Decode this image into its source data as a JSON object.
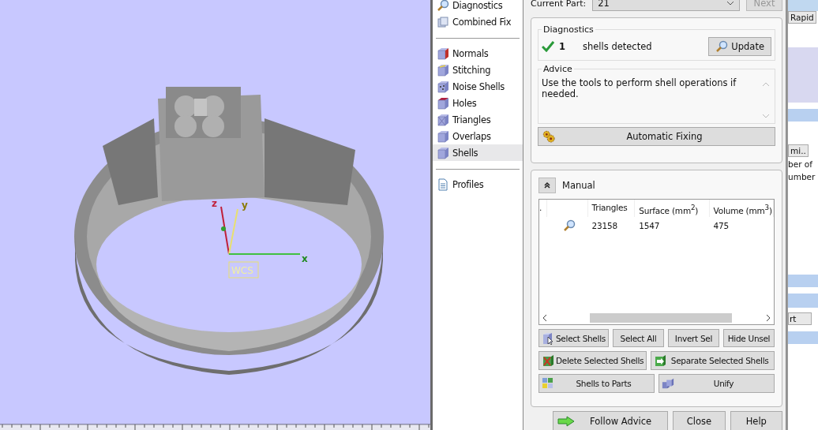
{
  "viewport": {
    "axes": {
      "z": "z",
      "y": "y",
      "x": "x",
      "label": "WCS"
    }
  },
  "nav": {
    "groups": [
      [
        {
          "label": "Diagnostics",
          "kind": "magnifier",
          "selected": false
        },
        {
          "label": "Combined Fix",
          "kind": "stack",
          "selected": false
        }
      ],
      [
        {
          "label": "Normals",
          "kind": "normals",
          "selected": false
        },
        {
          "label": "Stitching",
          "kind": "stitching",
          "selected": false
        },
        {
          "label": "Noise Shells",
          "kind": "noise",
          "selected": false
        },
        {
          "label": "Holes",
          "kind": "holes",
          "selected": false
        },
        {
          "label": "Triangles",
          "kind": "triangles",
          "selected": false
        },
        {
          "label": "Overlaps",
          "kind": "overlaps",
          "selected": false
        },
        {
          "label": "Shells",
          "kind": "shells",
          "selected": true
        }
      ],
      [
        {
          "label": "Profiles",
          "kind": "document",
          "selected": false
        }
      ]
    ]
  },
  "part": {
    "label": "Current Part:",
    "value": "21",
    "next": {
      "label": "Next",
      "disabled": true
    }
  },
  "diagnostics": {
    "title": "Diagnostics",
    "ok": true,
    "count": "1",
    "text": "shells detected",
    "update": "Update"
  },
  "advice": {
    "title": "Advice",
    "text": "Use the tools to perform shell operations if needed."
  },
  "automatic_fixing": "Automatic Fixing",
  "manual": {
    "title": "Manual",
    "expanded": true,
    "table": {
      "columns": [
        ".",
        "",
        "Triangles",
        "Surface (mm$^{2}$)",
        "Volume (mm$^{3}$)"
      ],
      "rows": [
        {
          "cells": [
            "",
            "",
            "23158",
            "1547",
            "475"
          ]
        }
      ]
    },
    "button_rows": [
      [
        {
          "label": "Select Shells",
          "kind": "select"
        },
        {
          "label": "Select All",
          "kind": "plain"
        },
        {
          "label": "Invert Sel",
          "kind": "plain"
        },
        {
          "label": "Hide Unsel",
          "kind": "plain"
        }
      ],
      [
        {
          "label": "Delete Selected Shells",
          "kind": "delete"
        },
        {
          "label": "Separate Selected Shells",
          "kind": "separate"
        }
      ],
      [
        {
          "label": "Shells to Parts",
          "kind": "parts"
        },
        {
          "label": "Unify",
          "kind": "unify"
        }
      ]
    ]
  },
  "footer": [
    {
      "label": "Follow Advice",
      "kind": "arrow"
    },
    {
      "label": "Close",
      "kind": "plain"
    },
    {
      "label": "Help",
      "kind": "plain"
    }
  ],
  "side_panel": {
    "tabs": [
      "Rapid",
      "mi.."
    ],
    "labels": [
      "ber of",
      "umber"
    ],
    "button": "rt"
  }
}
